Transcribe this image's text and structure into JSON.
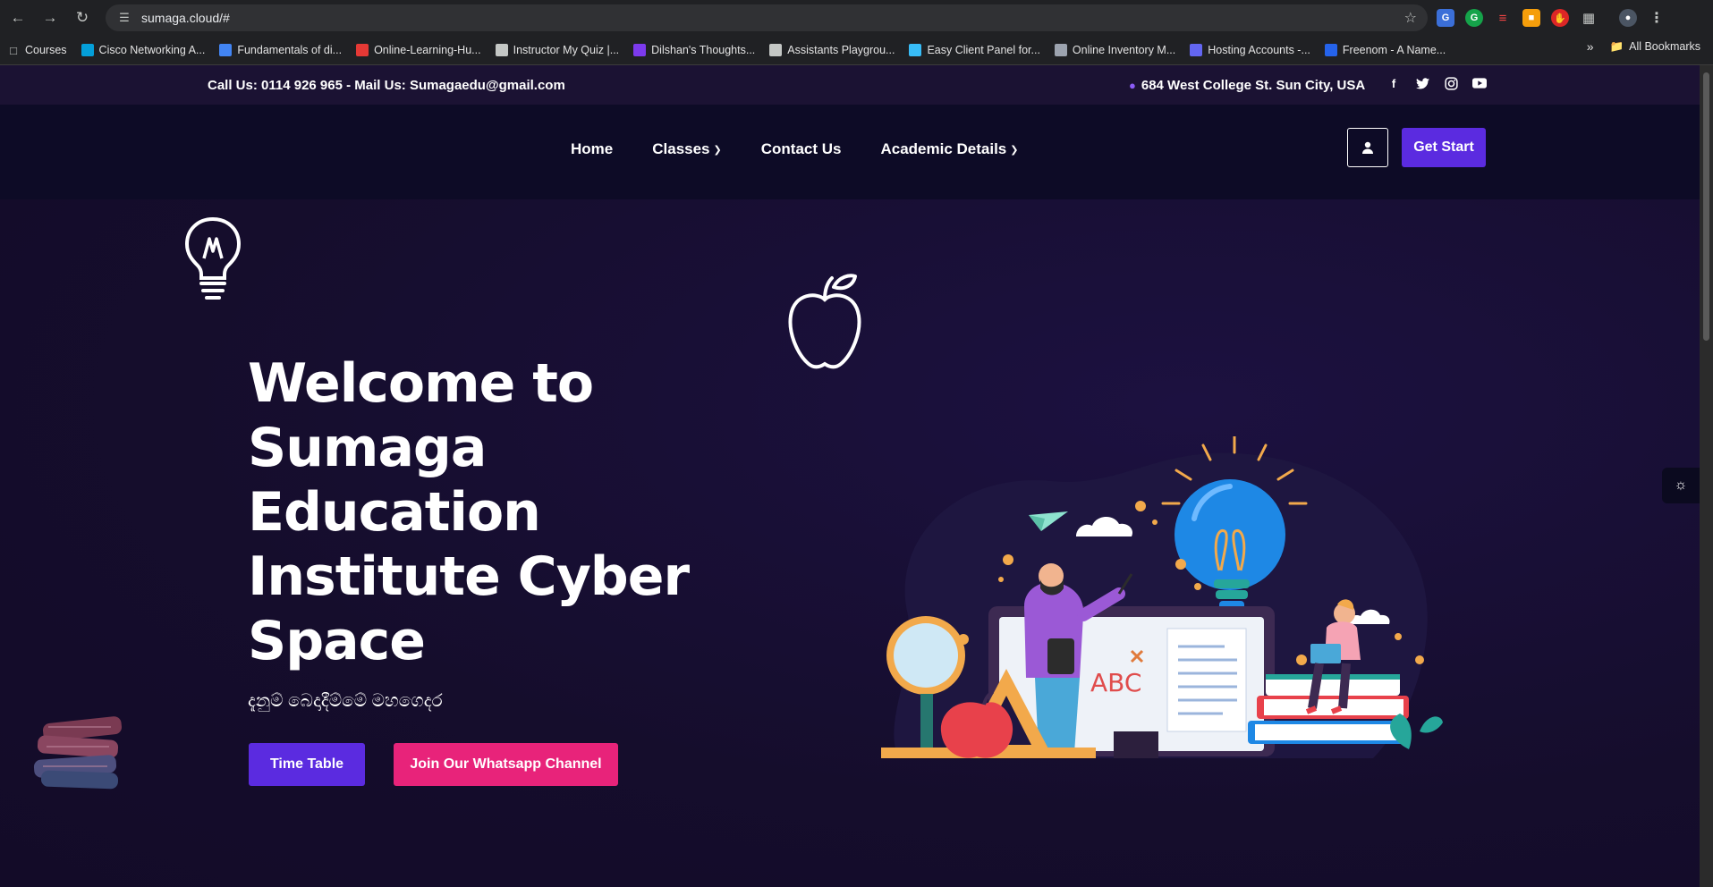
{
  "browser": {
    "url": "sumaga.cloud/#",
    "bookmarks": [
      {
        "label": "Courses",
        "icon": "folder-icon",
        "color": "#c4c7c5"
      },
      {
        "label": "Cisco Networking A...",
        "icon": "cisco-icon",
        "color": "#049fd9"
      },
      {
        "label": "Fundamentals of di...",
        "icon": "google-icon",
        "color": "#4285f4"
      },
      {
        "label": "Online-Learning-Hu...",
        "icon": "hub-icon",
        "color": "#e53935"
      },
      {
        "label": "Instructor My Quiz |...",
        "icon": "globe-icon",
        "color": "#c4c7c5"
      },
      {
        "label": "Dilshan's Thoughts...",
        "icon": "chart-icon",
        "color": "#7c3aed"
      },
      {
        "label": "Assistants Playgrou...",
        "icon": "openai-icon",
        "color": "#c4c7c5"
      },
      {
        "label": "Easy Client Panel for...",
        "icon": "cloud-icon",
        "color": "#38bdf8"
      },
      {
        "label": "Online Inventory M...",
        "icon": "gear-icon",
        "color": "#9ca3af"
      },
      {
        "label": "Hosting Accounts -...",
        "icon": "infinity-icon",
        "color": "#6366f1"
      },
      {
        "label": "Freenom - A Name...",
        "icon": "freenom-icon",
        "color": "#2563eb"
      }
    ],
    "all_bookmarks": "All Bookmarks"
  },
  "topbar": {
    "contact": "Call Us: 0114 926 965 - Mail Us: Sumagaedu@gmail.com",
    "address": "684 West College St. Sun City, USA",
    "socials": [
      "facebook-icon",
      "twitter-icon",
      "instagram-icon",
      "youtube-icon"
    ]
  },
  "nav": {
    "home": "Home",
    "classes": "Classes",
    "contact": "Contact Us",
    "academic": "Academic Details",
    "get_start": "Get Start"
  },
  "hero": {
    "title": "Welcome to Sumaga Education Institute Cyber Space",
    "tagline": "දැනුම් බෙදාදීම්මේ මහගෙදර",
    "btn_timetable": "Time Table",
    "btn_whatsapp": "Join Our Whatsapp Channel",
    "illustration_letters": "ABC"
  },
  "colors": {
    "accent": "#5b2be0",
    "pink": "#e8237a",
    "bg": "#170f2e"
  }
}
